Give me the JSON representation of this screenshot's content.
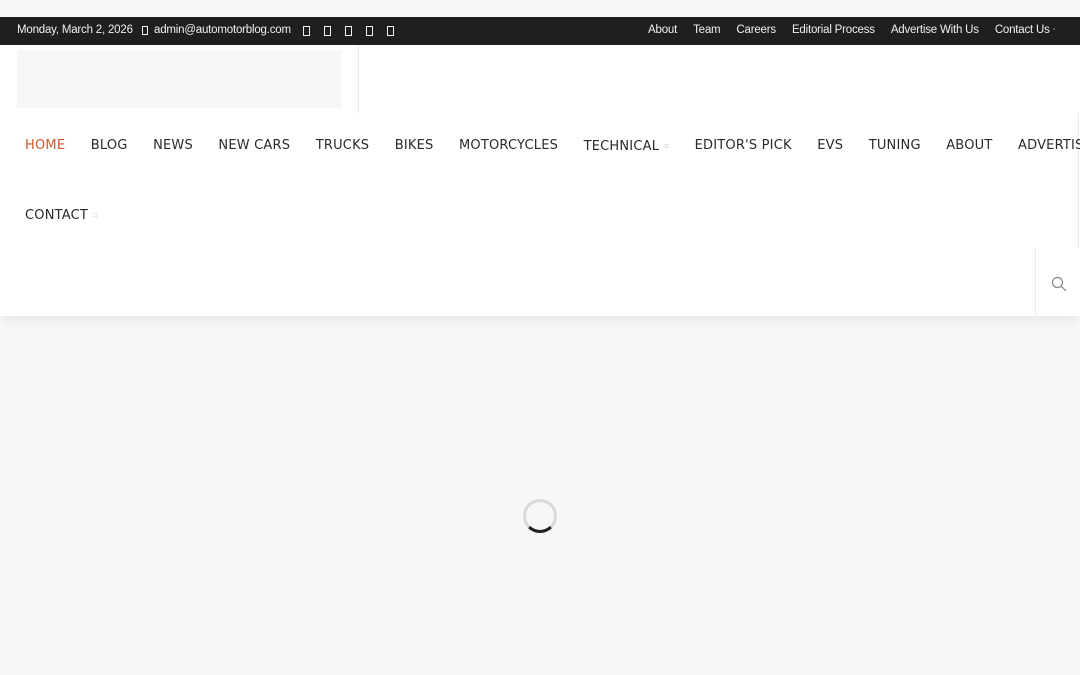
{
  "topbar": {
    "date": "Monday, March 2, 2026",
    "email": "admin@automotorblog.com",
    "social_icons": [
      "social-icon-1",
      "social-icon-2",
      "social-icon-3",
      "social-icon-4",
      "social-icon-5"
    ],
    "links": [
      "About",
      "Team",
      "Careers",
      "Editorial Process",
      "Advertise With Us",
      "Contact Us"
    ]
  },
  "menu": {
    "active": "HOME",
    "row1": [
      "HOME",
      "BLOG",
      "NEWS",
      "NEW CARS",
      "TRUCKS",
      "BIKES",
      "MOTORCYCLES",
      "TECHNICAL",
      "EDITOR'S PICK",
      "EVS",
      "TUNING",
      "ABOUT",
      "ADVERTISE"
    ],
    "row2": [
      "CONTACT"
    ],
    "with_submenu": [
      "TECHNICAL",
      "CONTACT"
    ]
  },
  "icons": {
    "search": "search-icon",
    "mail": "mail-icon",
    "loader": "loading-spinner"
  },
  "colors": {
    "topbar_bg": "#1f1f1f",
    "accent": "#d2572c",
    "page_bg": "#f8f8f8"
  }
}
